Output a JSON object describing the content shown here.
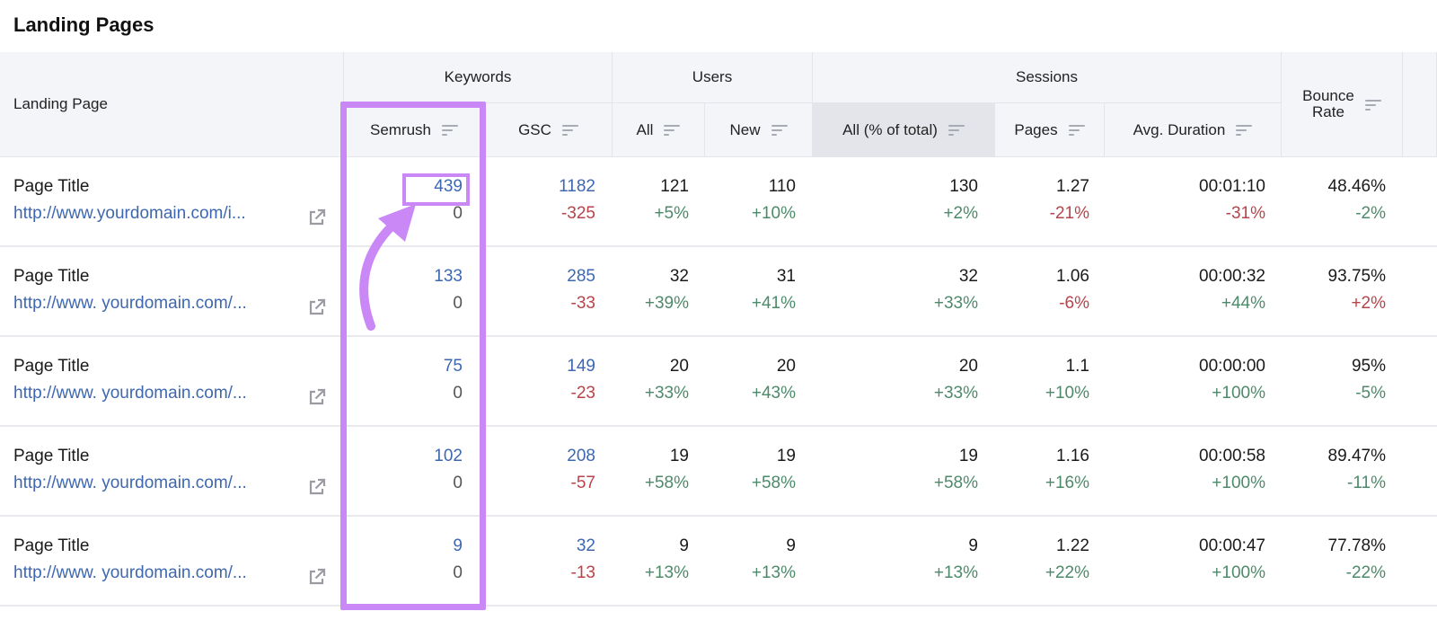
{
  "title": "Landing Pages",
  "header": {
    "landing_page": "Landing Page",
    "groups": {
      "keywords": "Keywords",
      "users": "Users",
      "sessions": "Sessions"
    },
    "columns": {
      "semrush": "Semrush",
      "gsc": "GSC",
      "users_all": "All",
      "users_new": "New",
      "sessions_all": "All (% of total)",
      "pages": "Pages",
      "avg_duration": "Avg. Duration",
      "bounce_rate_line1": "Bounce",
      "bounce_rate_line2": "Rate"
    },
    "selected_column": "sessions_all",
    "sort_icon": "sort-lines-icon"
  },
  "rows": [
    {
      "title": "Page Title",
      "url": "http://www.yourdomain.com/i...",
      "semrush": "439",
      "semrush_delta": "0",
      "gsc": "1182",
      "gsc_delta": "-325",
      "users_all": "121",
      "users_all_delta": "+5%",
      "users_new": "110",
      "users_new_delta": "+10%",
      "sessions_all": "130",
      "sessions_all_delta": "+2%",
      "pages": "1.27",
      "pages_delta": "-21%",
      "avg_duration": "00:01:10",
      "avg_duration_delta": "-31%",
      "bounce_rate": "48.46%",
      "bounce_rate_delta": "-2%",
      "bounce_rate_good": true
    },
    {
      "title": "Page Title",
      "url": "http://www. yourdomain.com/...",
      "semrush": "133",
      "semrush_delta": "0",
      "gsc": "285",
      "gsc_delta": "-33",
      "users_all": "32",
      "users_all_delta": "+39%",
      "users_new": "31",
      "users_new_delta": "+41%",
      "sessions_all": "32",
      "sessions_all_delta": "+33%",
      "pages": "1.06",
      "pages_delta": "-6%",
      "avg_duration": "00:00:32",
      "avg_duration_delta": "+44%",
      "bounce_rate": "93.75%",
      "bounce_rate_delta": "+2%",
      "bounce_rate_good": false
    },
    {
      "title": "Page Title",
      "url": "http://www. yourdomain.com/...",
      "semrush": "75",
      "semrush_delta": "0",
      "gsc": "149",
      "gsc_delta": "-23",
      "users_all": "20",
      "users_all_delta": "+33%",
      "users_new": "20",
      "users_new_delta": "+43%",
      "sessions_all": "20",
      "sessions_all_delta": "+33%",
      "pages": "1.1",
      "pages_delta": "+10%",
      "avg_duration": "00:00:00",
      "avg_duration_delta": "+100%",
      "bounce_rate": "95%",
      "bounce_rate_delta": "-5%",
      "bounce_rate_good": true
    },
    {
      "title": "Page Title",
      "url": "http://www. yourdomain.com/...",
      "semrush": "102",
      "semrush_delta": "0",
      "gsc": "208",
      "gsc_delta": "-57",
      "users_all": "19",
      "users_all_delta": "+58%",
      "users_new": "19",
      "users_new_delta": "+58%",
      "sessions_all": "19",
      "sessions_all_delta": "+58%",
      "pages": "1.16",
      "pages_delta": "+16%",
      "avg_duration": "00:00:58",
      "avg_duration_delta": "+100%",
      "bounce_rate": "89.47%",
      "bounce_rate_delta": "-11%",
      "bounce_rate_good": true
    },
    {
      "title": "Page Title",
      "url": "http://www. yourdomain.com/...",
      "semrush": "9",
      "semrush_delta": "0",
      "gsc": "32",
      "gsc_delta": "-13",
      "users_all": "9",
      "users_all_delta": "+13%",
      "users_new": "9",
      "users_new_delta": "+13%",
      "sessions_all": "9",
      "sessions_all_delta": "+13%",
      "pages": "1.22",
      "pages_delta": "+22%",
      "avg_duration": "00:00:47",
      "avg_duration_delta": "+100%",
      "bounce_rate": "77.78%",
      "bounce_rate_delta": "-22%",
      "bounce_rate_good": true
    }
  ],
  "annotation": {
    "highlight_color": "#c988f5",
    "highlighted_column": "semrush",
    "highlighted_value": "439"
  },
  "colors": {
    "link": "#3d67b1",
    "positive": "#4d8a6a",
    "negative": "#b8434a",
    "header_bg": "#f4f5f9",
    "selected_header_bg": "#e4e5ea"
  }
}
